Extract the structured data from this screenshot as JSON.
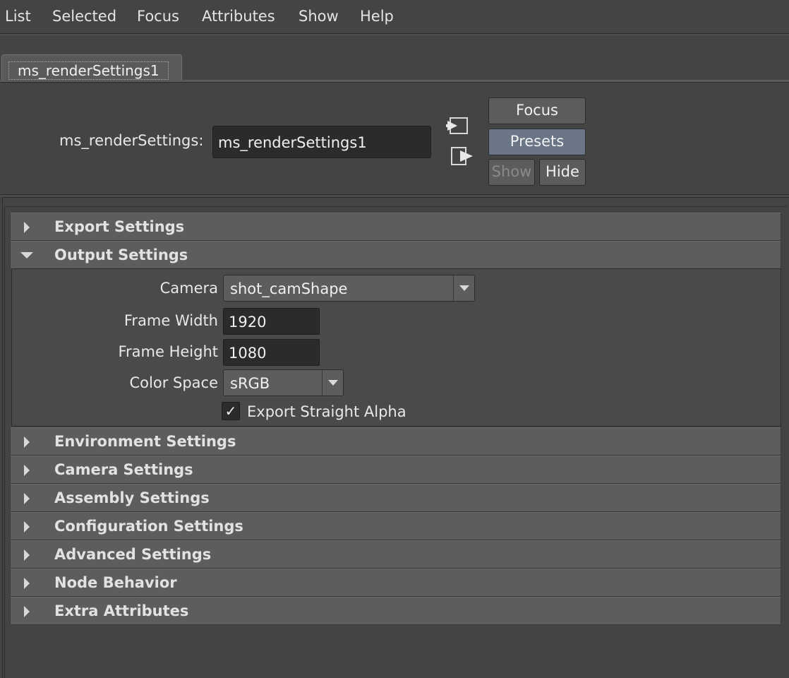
{
  "menubar": {
    "items": [
      "List",
      "Selected",
      "Focus",
      "Attributes",
      "Show",
      "Help"
    ]
  },
  "tabs": [
    {
      "label": "ms_renderSettings1"
    }
  ],
  "header": {
    "node_type_label": "ms_renderSettings:",
    "node_name_value": "ms_renderSettings1",
    "buttons": {
      "focus": "Focus",
      "presets": "Presets",
      "show": "Show",
      "hide": "Hide"
    },
    "icons": [
      "input-connection-icon",
      "output-connection-icon"
    ]
  },
  "sections": [
    {
      "title": "Export Settings",
      "expanded": false
    },
    {
      "title": "Output Settings",
      "expanded": true
    },
    {
      "title": "Environment Settings",
      "expanded": false
    },
    {
      "title": "Camera Settings",
      "expanded": false
    },
    {
      "title": "Assembly Settings",
      "expanded": false
    },
    {
      "title": "Configuration Settings",
      "expanded": false
    },
    {
      "title": "Advanced Settings",
      "expanded": false
    },
    {
      "title": "Node Behavior",
      "expanded": false
    },
    {
      "title": "Extra Attributes",
      "expanded": false
    }
  ],
  "output_settings": {
    "camera": {
      "label": "Camera",
      "value": "shot_camShape"
    },
    "frame_width": {
      "label": "Frame Width",
      "value": "1920"
    },
    "frame_height": {
      "label": "Frame Height",
      "value": "1080"
    },
    "color_space": {
      "label": "Color Space",
      "value": "sRGB"
    },
    "export_straight_alpha": {
      "label": "Export Straight Alpha",
      "checked": true,
      "glyph": "✓"
    }
  },
  "colors": {
    "background": "#444444",
    "section_header": "#5d5d5d",
    "field_bg": "#2b2b2b",
    "presets_button": "#6a7686"
  }
}
